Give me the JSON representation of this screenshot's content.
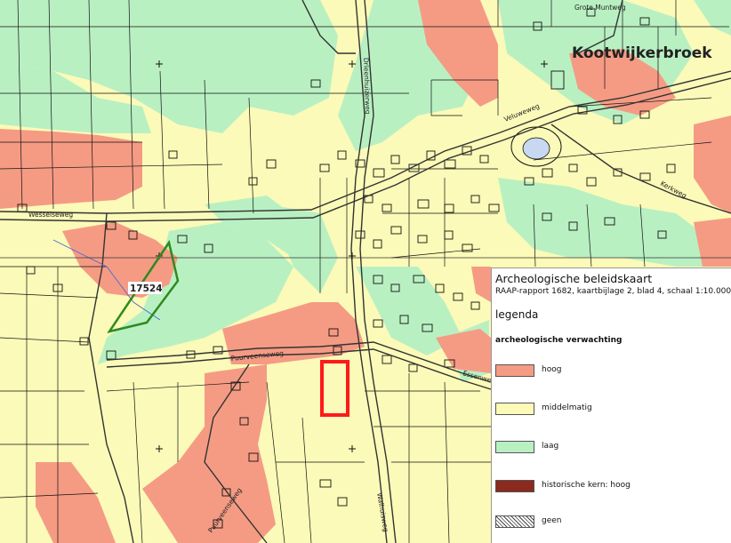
{
  "map": {
    "town_label": "Kootwijkerbroek",
    "parcel_label": "17524",
    "streets": {
      "grote_muntweg": "Grote Muntweg",
      "wesselseweg": "Wesselseweg",
      "drieenhuizerweg": "Drieenhuizerweg",
      "veluweweg": "Veluweweg",
      "kerkweg": "Kerkweg",
      "puurveenseweg_a": "Puurveenseweg",
      "puurveenseweg_b": "Puurveenseweg",
      "walhuisweg": "Walhuisweg",
      "essenweg": "Essenweg"
    },
    "colors": {
      "middelmatig": "#fbfab8",
      "laag": "#b9f0c2",
      "hoog": "#f59b84",
      "parcel_outline": "#2f8a1e",
      "study_area": "#ff1a1a"
    }
  },
  "legend": {
    "title": "Archeologische beleidskaart",
    "subtitle": "RAAP-rapport 1682, kaartbijlage 2, blad 4, schaal 1:10.000",
    "heading": "legenda",
    "category": "archeologische verwachting",
    "items": [
      {
        "label": "hoog",
        "color": "#f59b84"
      },
      {
        "label": "middelmatig",
        "color": "#fbfab8"
      },
      {
        "label": "laag",
        "color": "#b9f0c2"
      },
      {
        "label": "historische kern: hoog",
        "color": "#8b2a1e"
      },
      {
        "label": "geen",
        "color": "hatch"
      }
    ]
  }
}
